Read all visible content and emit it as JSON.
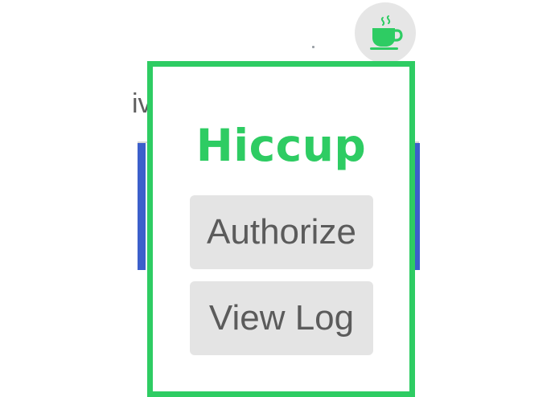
{
  "background": {
    "partial_text": "iv"
  },
  "extension": {
    "icon": "coffee-cup-icon",
    "accent_color": "#2ecc63"
  },
  "popup": {
    "title": "Hiccup",
    "border_color": "#2ecc63",
    "buttons": {
      "authorize_label": "Authorize",
      "view_log_label": "View Log"
    }
  }
}
